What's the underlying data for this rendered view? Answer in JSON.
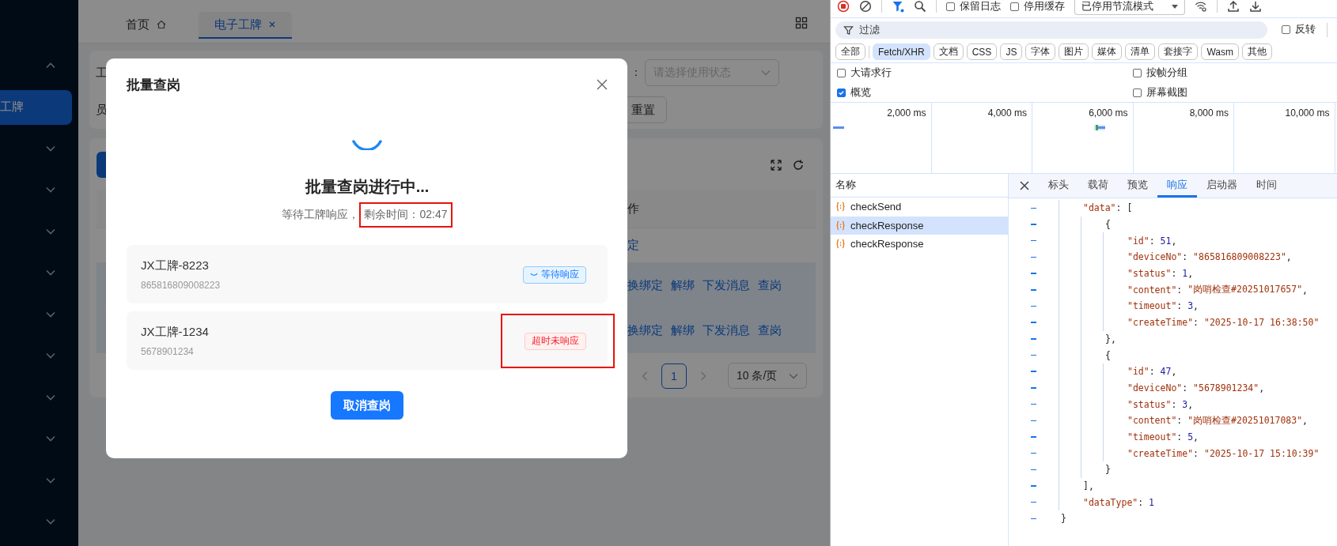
{
  "sidebar": {
    "items": [
      {
        "kind": "group",
        "expanded": true
      },
      {
        "kind": "link",
        "label": "工牌",
        "selected": true
      },
      {
        "kind": "group",
        "expanded": false
      },
      {
        "kind": "group",
        "expanded": false
      },
      {
        "kind": "group",
        "expanded": false
      },
      {
        "kind": "group",
        "expanded": false
      },
      {
        "kind": "group",
        "expanded": false
      },
      {
        "kind": "group",
        "expanded": false
      },
      {
        "kind": "group",
        "expanded": false
      },
      {
        "kind": "group",
        "expanded": false
      },
      {
        "kind": "group",
        "expanded": false
      },
      {
        "kind": "group",
        "expanded": false
      }
    ]
  },
  "tabs": [
    {
      "label": "首页",
      "selected": false,
      "closable": false
    },
    {
      "label": "电子工牌",
      "selected": true,
      "closable": true
    }
  ],
  "filters": {
    "label_1": "工",
    "label_2": "员",
    "select_label": "：",
    "select_placeholder": "请选择使用状态",
    "reset_button": "重置"
  },
  "table": {
    "header": "作",
    "rows": [
      {
        "selected": false,
        "actions": [
          "定"
        ]
      },
      {
        "selected": true,
        "actions": [
          "换绑定",
          "解绑",
          "下发消息",
          "查岗"
        ]
      },
      {
        "selected": true,
        "actions": [
          "换绑定",
          "解绑",
          "下发消息",
          "查岗"
        ]
      }
    ]
  },
  "pagination": {
    "page": "1",
    "page_size": "10 条/页"
  },
  "dialog": {
    "title": "批量查岗",
    "heading": "批量查岗进行中...",
    "subtitle": "等待工牌响应，",
    "remaining": {
      "text": "剩余时间：02:47",
      "highlighted": true
    },
    "devices": [
      {
        "name": "JX工牌-8223",
        "device_no": "865816809008223",
        "kind": "waiting",
        "status_label": "等待响应",
        "highlighted": false
      },
      {
        "name": "JX工牌-1234",
        "device_no": "5678901234",
        "kind": "timeout",
        "status_label": "超时未响应",
        "highlighted": true
      }
    ],
    "cancel_button": "取消查岗"
  },
  "devtools": {
    "toolbar": {
      "recording": true,
      "filter_active": true,
      "checkboxes": [
        {
          "label": "保留日志",
          "checked": false
        },
        {
          "label": "停用缓存",
          "checked": false
        }
      ],
      "throttle": "已停用节流模式"
    },
    "filter": {
      "placeholder": "过滤",
      "invert": {
        "label": "反转",
        "checked": false
      }
    },
    "types": [
      {
        "label": "全部",
        "selected": false
      },
      {
        "label": "Fetch/XHR",
        "selected": true
      },
      {
        "label": "文档",
        "selected": false
      },
      {
        "label": "CSS",
        "selected": false
      },
      {
        "label": "JS",
        "selected": false
      },
      {
        "label": "字体",
        "selected": false
      },
      {
        "label": "图片",
        "selected": false
      },
      {
        "label": "媒体",
        "selected": false
      },
      {
        "label": "清单",
        "selected": false
      },
      {
        "label": "套接字",
        "selected": false
      },
      {
        "label": "Wasm",
        "selected": false
      },
      {
        "label": "其他",
        "selected": false
      }
    ],
    "options": [
      {
        "label": "大请求行",
        "checked": false
      },
      {
        "label": "按帧分组",
        "checked": false
      },
      {
        "label": "概览",
        "checked": true
      },
      {
        "label": "屏幕截图",
        "checked": false
      }
    ],
    "timeline_ticks": [
      "2,000 ms",
      "4,000 ms",
      "6,000 ms",
      "8,000 ms",
      "10,000 ms"
    ],
    "requests_header": "名称",
    "requests": [
      {
        "name": "checkSend",
        "selected": false
      },
      {
        "name": "checkResponse",
        "selected": true
      },
      {
        "name": "checkResponse",
        "selected": false
      }
    ],
    "detail_tabs": [
      {
        "label": "标头",
        "selected": false
      },
      {
        "label": "载荷",
        "selected": false
      },
      {
        "label": "预览",
        "selected": false
      },
      {
        "label": "响应",
        "selected": true
      },
      {
        "label": "启动器",
        "selected": false
      },
      {
        "label": "时间",
        "selected": false
      }
    ],
    "response": {
      "close": "}",
      "children": [
        {
          "open": "\"data\": [",
          "close": "],",
          "children": [
            {
              "open": "{",
              "close": "},",
              "children": [
                {
                  "text": "\"id\": 51,"
                },
                {
                  "text": "\"deviceNo\": \"865816809008223\","
                },
                {
                  "text": "\"status\": 1,"
                },
                {
                  "text": "\"content\": \"岗哨检查#20251017657\","
                },
                {
                  "text": "\"timeout\": 3,"
                },
                {
                  "text": "\"createTime\": \"2025-10-17 16:38:50\""
                }
              ]
            },
            {
              "open": "{",
              "close": "}",
              "children": [
                {
                  "text": "\"id\": 47,"
                },
                {
                  "text": "\"deviceNo\": \"5678901234\","
                },
                {
                  "text": "\"status\": 3,"
                },
                {
                  "text": "\"content\": \"岗哨检查#20251017083\","
                },
                {
                  "text": "\"timeout\": 5,"
                },
                {
                  "text": "\"createTime\": \"2025-10-17 15:10:39\""
                }
              ]
            }
          ]
        },
        {
          "text": "\"dataType\": 1"
        }
      ]
    }
  }
}
